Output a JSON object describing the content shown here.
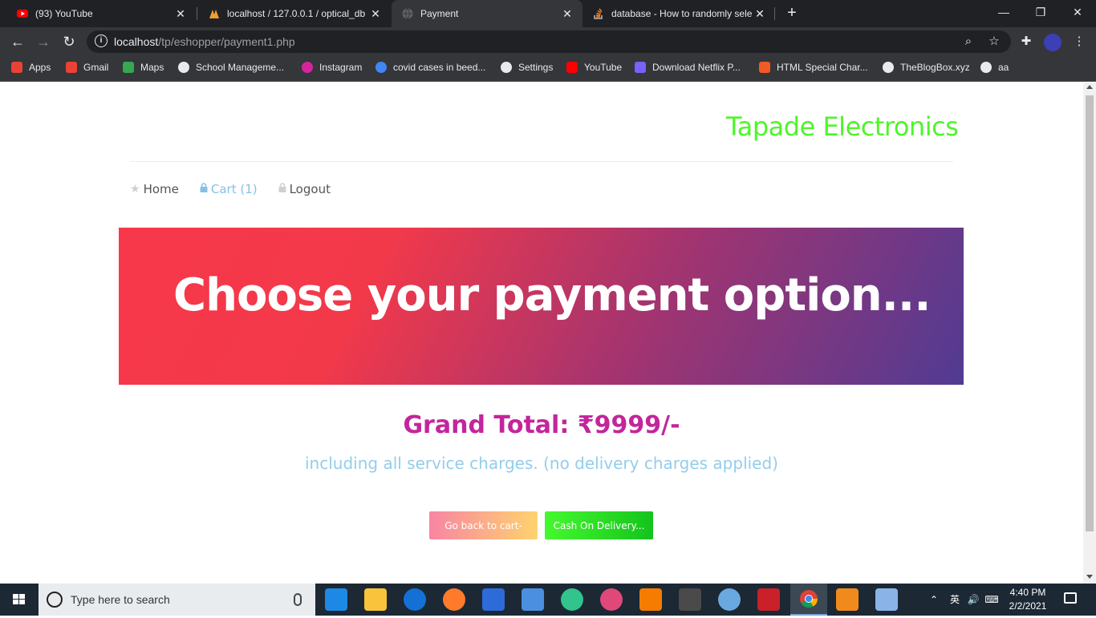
{
  "browser": {
    "tabs": [
      {
        "title": "(93) YouTube",
        "icon": "youtube-icon",
        "active": false
      },
      {
        "title": "localhost / 127.0.0.1 / optical_db",
        "icon": "phpmyadmin-icon",
        "active": false
      },
      {
        "title": "Payment",
        "icon": "globe-icon",
        "active": true
      },
      {
        "title": "database - How to randomly sele",
        "icon": "stackoverflow-icon",
        "active": false
      }
    ],
    "url_host": "localhost",
    "url_path": "/tp/eshopper/payment1.php",
    "bookmarks": [
      {
        "label": "Apps",
        "icon": "apps-grid-icon",
        "color": "#ea4335"
      },
      {
        "label": "Gmail",
        "icon": "gmail-icon",
        "color": "#ea4335"
      },
      {
        "label": "Maps",
        "icon": "maps-pin-icon",
        "color": "#34a853"
      },
      {
        "label": "School Manageme...",
        "icon": "globe-icon",
        "color": "#e8eaed"
      },
      {
        "label": "Instagram",
        "icon": "instagram-icon",
        "color": "#d6249f"
      },
      {
        "label": "covid cases in beed...",
        "icon": "google-icon",
        "color": "#4285f4"
      },
      {
        "label": "Settings",
        "icon": "gear-icon",
        "color": "#e8eaed"
      },
      {
        "label": "YouTube",
        "icon": "youtube-icon",
        "color": "#ff0000"
      },
      {
        "label": "Download Netflix P...",
        "icon": "m-logo-icon",
        "color": "#7b61ff"
      },
      {
        "label": "HTML Special Char...",
        "icon": "html-icon",
        "color": "#f15a24"
      },
      {
        "label": "TheBlogBox.xyz",
        "icon": "globe-icon",
        "color": "#e8eaed"
      },
      {
        "label": "aa",
        "icon": "globe-icon",
        "color": "#e8eaed"
      }
    ]
  },
  "page": {
    "brand": "Tapade Electronics",
    "nav": [
      {
        "label": "Home",
        "icon": "star-icon"
      },
      {
        "label": "Cart (1)",
        "icon": "lock-icon"
      },
      {
        "label": "Logout",
        "icon": "lock-icon"
      }
    ],
    "hero_title": "Choose your payment option...",
    "grand_total": "Grand Total: ₹9999/-",
    "note": "including all service charges. (no delivery charges applied)",
    "buttons": {
      "back": "Go back to cart-",
      "cod": "Cash On Delivery..."
    }
  },
  "taskbar": {
    "search_placeholder": "Type here to search",
    "time": "4:40 PM",
    "date": "2/2/2021"
  }
}
